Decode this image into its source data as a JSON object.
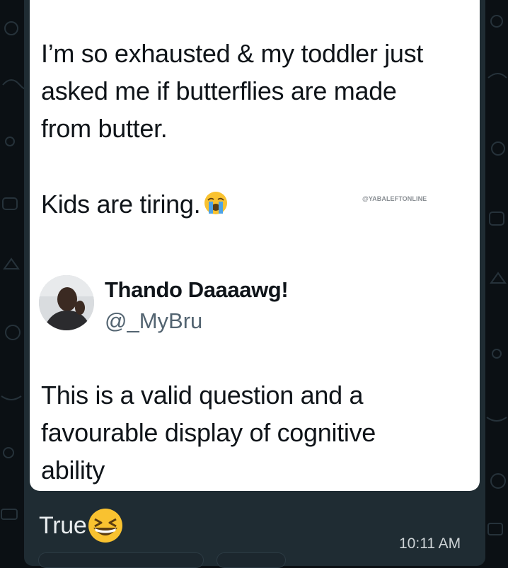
{
  "tweet": {
    "text_1": "I’m so exhausted & my toddler just\nasked me if butterflies are made\nfrom butter.",
    "text_2": "Kids are tiring.",
    "text_2_emoji": "loudly-crying-face-emoji",
    "watermark": "@YABALEFTONLINE",
    "reply": {
      "display_name": "Thando Daaaawg!",
      "handle": "@_MyBru",
      "text": "This is a valid question and a\nfavourable display of cognitive\nability"
    }
  },
  "message": {
    "caption": "True",
    "caption_emoji": "grinning-squinting-face-emoji",
    "time": "10:11 AM"
  },
  "colors": {
    "chat_background": "#0b1014",
    "bubble": "#1f2c33",
    "card": "#ffffff",
    "handle_gray": "#536471",
    "caption_text": "#e9edef"
  }
}
